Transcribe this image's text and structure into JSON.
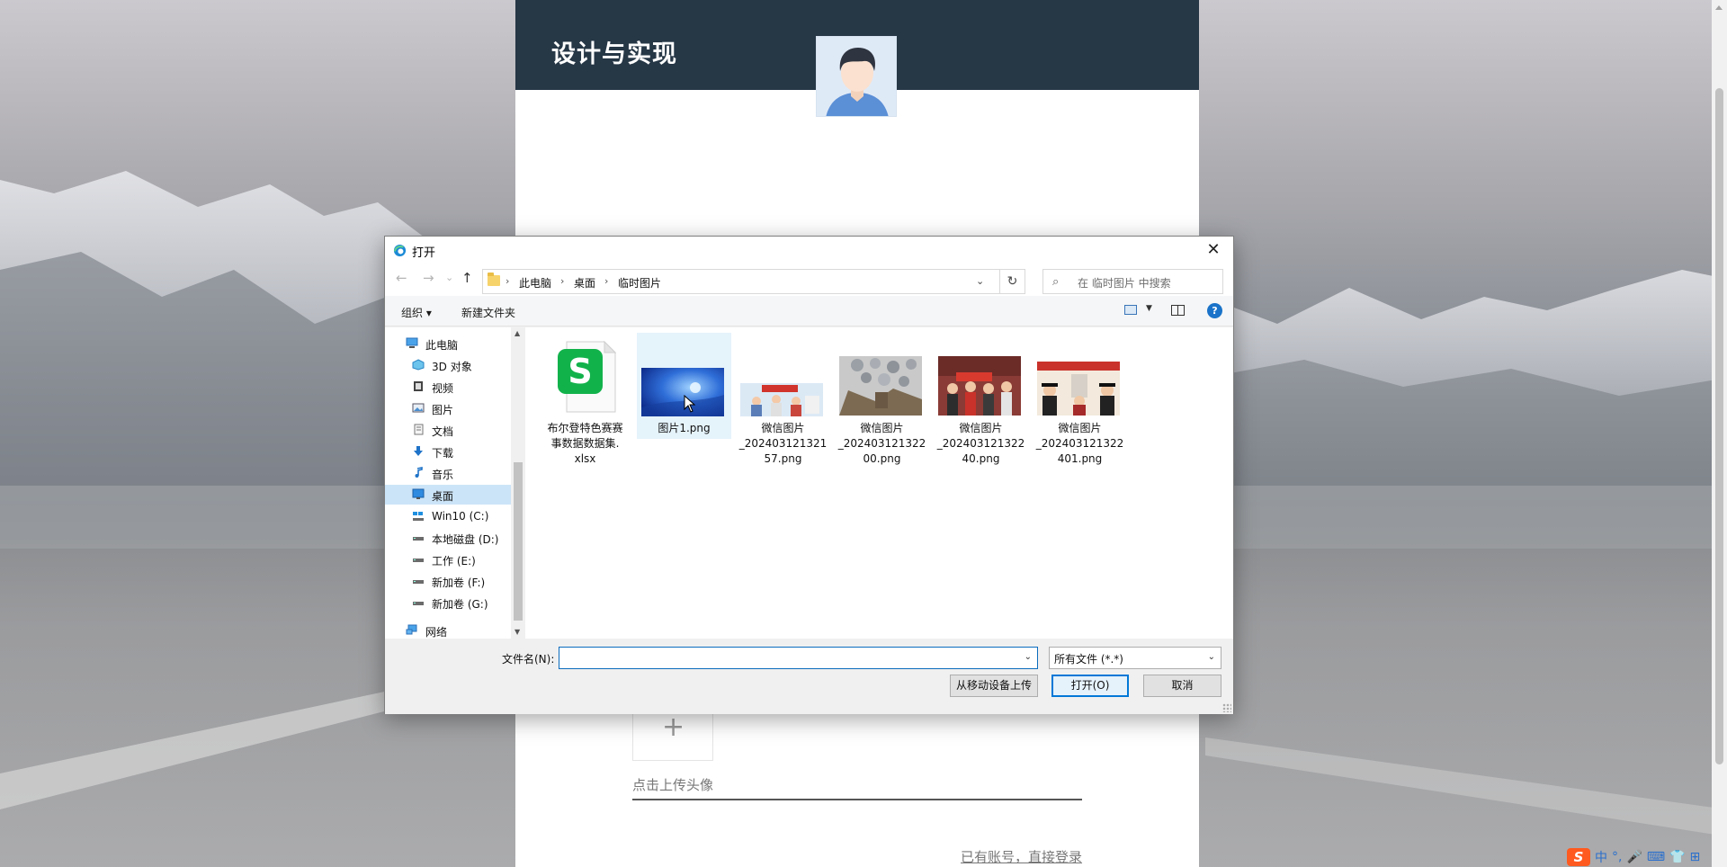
{
  "page": {
    "title": "设计与实现",
    "upload_plus": "+",
    "upload_hint": "点击上传头像",
    "login_link": "已有账号，直接登录"
  },
  "dialog": {
    "title": "打开",
    "close": "✕",
    "nav": {
      "back": "←",
      "forward": "→",
      "recent": "⌄",
      "up": "↑",
      "refresh": "↻"
    },
    "breadcrumb": [
      "此电脑",
      "桌面",
      "临时图片"
    ],
    "breadcrumb_sep": "›",
    "address_dropdown": "⌄",
    "search_placeholder": "在 临时图片 中搜索",
    "search_icon": "⌕",
    "toolbar": {
      "organize": "组织 ▾",
      "new_folder": "新建文件夹",
      "view_dd": "▼",
      "help": "?"
    },
    "sidebar": {
      "scroll_up": "▲",
      "scroll_down": "▼",
      "items": [
        {
          "label": "此电脑",
          "icon": "computer-icon"
        },
        {
          "label": "3D 对象",
          "icon": "cube-icon"
        },
        {
          "label": "视频",
          "icon": "video-icon"
        },
        {
          "label": "图片",
          "icon": "picture-icon"
        },
        {
          "label": "文档",
          "icon": "document-icon"
        },
        {
          "label": "下载",
          "icon": "download-icon"
        },
        {
          "label": "音乐",
          "icon": "music-icon"
        },
        {
          "label": "桌面",
          "icon": "desktop-icon"
        },
        {
          "label": "Win10 (C:)",
          "icon": "drive-icon"
        },
        {
          "label": "本地磁盘 (D:)",
          "icon": "drive-icon"
        },
        {
          "label": "工作 (E:)",
          "icon": "drive-icon"
        },
        {
          "label": "新加卷 (F:)",
          "icon": "drive-icon"
        },
        {
          "label": "新加卷 (G:)",
          "icon": "drive-icon"
        },
        {
          "label": "网络",
          "icon": "network-icon"
        }
      ],
      "selected": "桌面"
    },
    "files": [
      {
        "name_lines": [
          "布尔登特色赛赛",
          "事数据数据集.",
          "xlsx"
        ],
        "icon": "spreadsheet-icon"
      },
      {
        "name_lines": [
          "图片1.png"
        ],
        "icon": "image-thumbnail",
        "selected": true
      },
      {
        "name_lines": [
          "微信图片",
          "_202403121321",
          "57.png"
        ],
        "icon": "image-thumbnail"
      },
      {
        "name_lines": [
          "微信图片",
          "_202403121322",
          "00.png"
        ],
        "icon": "image-thumbnail"
      },
      {
        "name_lines": [
          "微信图片",
          "_202403121322",
          "40.png"
        ],
        "icon": "image-thumbnail"
      },
      {
        "name_lines": [
          "微信图片",
          "_202403121322",
          "401.png"
        ],
        "icon": "image-thumbnail"
      }
    ],
    "spreadsheet_letter": "S",
    "filename_label": "文件名(N):",
    "filename_value": "",
    "filename_dd": "⌄",
    "filetype_value": "所有文件 (*.*)",
    "filetype_dd": "⌄",
    "buttons": {
      "mobile_upload": "从移动设备上传",
      "open": "打开(O)",
      "cancel": "取消"
    }
  },
  "ime": {
    "logo": "S",
    "lang": "中",
    "punct": "°,",
    "mic": "🎤",
    "keyboard": "⌨",
    "shirt": "👕",
    "grid": "⊞"
  },
  "colors": {
    "header_bg": "#263746",
    "accent": "#0078d7",
    "selection": "#cce4f7"
  }
}
